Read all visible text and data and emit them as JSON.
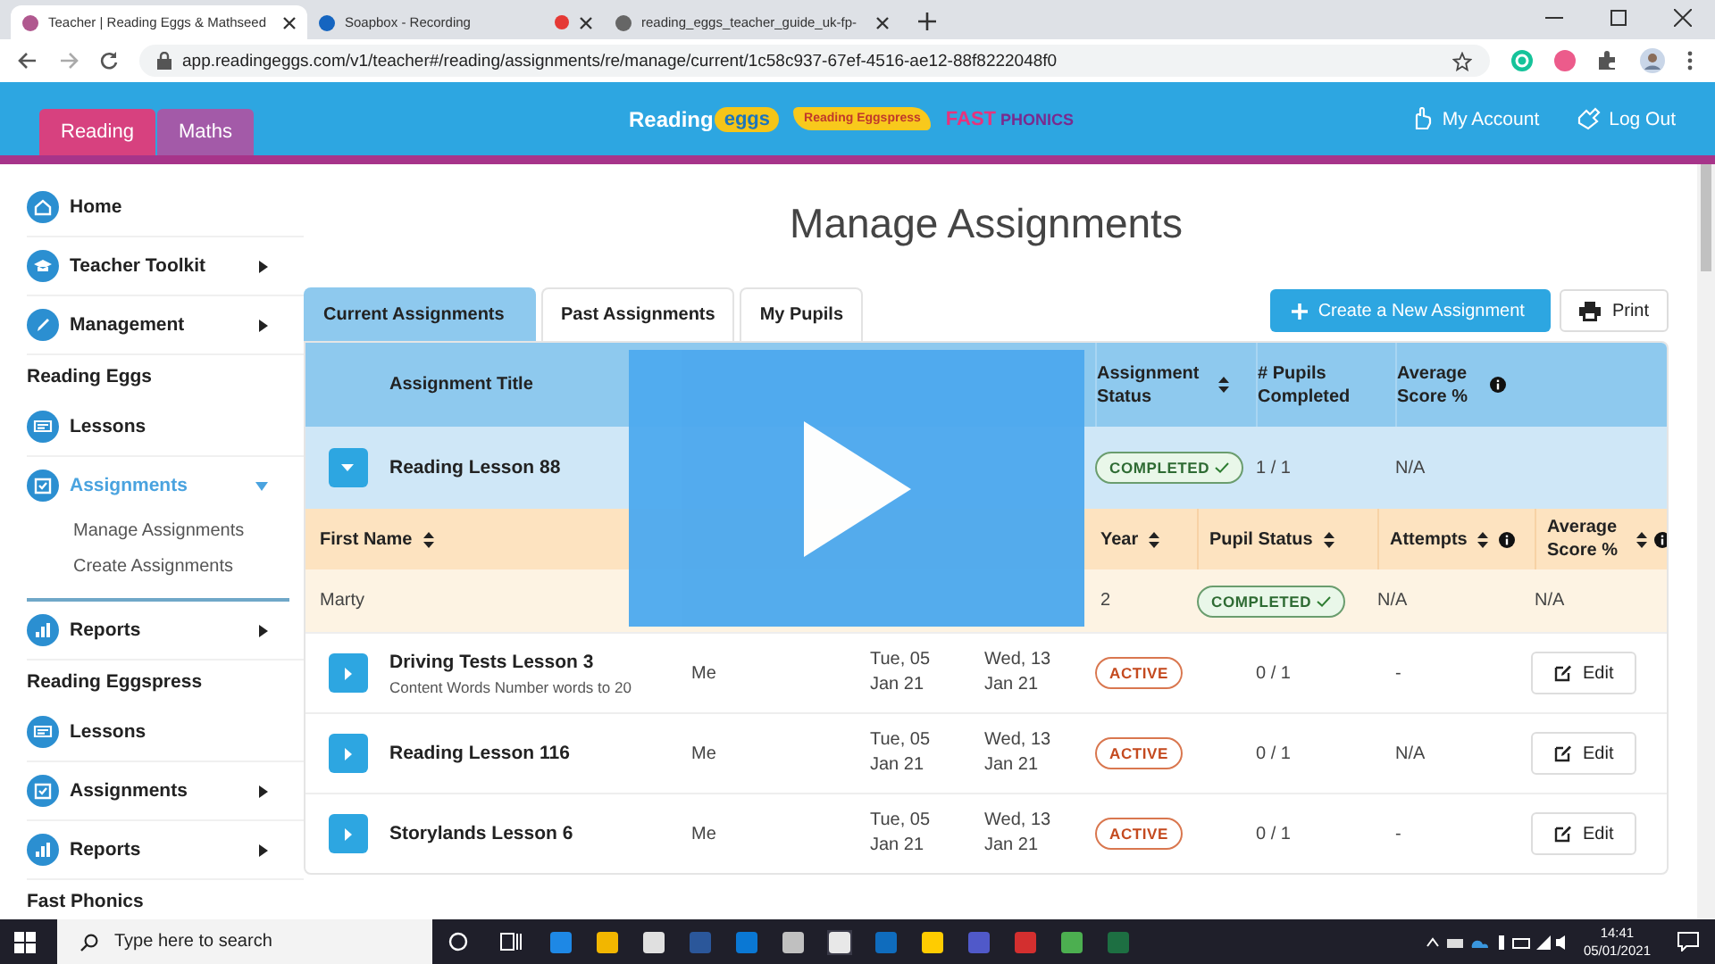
{
  "browser": {
    "tabs": [
      {
        "title": "Teacher | Reading Eggs & Mathseed",
        "selected": true,
        "recording": false
      },
      {
        "title": "Soapbox - Recording",
        "selected": false,
        "recording": true
      },
      {
        "title": "reading_eggs_teacher_guide_uk-fp-",
        "selected": false,
        "recording": false
      }
    ],
    "address": "app.readingeggs.com/v1/teacher#/reading/assignments/re/manage/current/1c58c937-67ef-4516-ae12-88f8222048f0"
  },
  "header": {
    "subject_tabs": [
      {
        "label": "Reading",
        "selected": true
      },
      {
        "label": "Maths",
        "selected": false
      }
    ],
    "logos": [
      "Reading",
      "eggs",
      "Reading Eggspress",
      "FAST",
      "PHONICS"
    ],
    "links": [
      "My Account",
      "Log Out"
    ]
  },
  "sidebar": {
    "items": [
      {
        "kind": "item",
        "label": "Home",
        "selected": false
      },
      {
        "kind": "item",
        "label": "Teacher Toolkit",
        "selected": false,
        "expanded": false
      },
      {
        "kind": "item",
        "label": "Management",
        "selected": false,
        "expanded": false
      },
      {
        "kind": "section",
        "label": "Reading Eggs"
      },
      {
        "kind": "item",
        "label": "Lessons",
        "selected": false
      },
      {
        "kind": "item",
        "label": "Assignments",
        "selected": true,
        "expanded": true,
        "children": [
          {
            "label": "Manage Assignments"
          },
          {
            "label": "Create Assignments"
          }
        ]
      },
      {
        "kind": "item",
        "label": "Reports",
        "selected": false,
        "expanded": false
      },
      {
        "kind": "section",
        "label": "Reading Eggspress"
      },
      {
        "kind": "item",
        "label": "Lessons",
        "selected": false
      },
      {
        "kind": "item",
        "label": "Assignments",
        "selected": false,
        "expanded": false
      },
      {
        "kind": "item",
        "label": "Reports",
        "selected": false,
        "expanded": false
      },
      {
        "kind": "section",
        "label": "Fast Phonics"
      }
    ]
  },
  "page_title": "Manage Assignments",
  "tabs": [
    {
      "label": "Current Assignments",
      "selected": true
    },
    {
      "label": "Past Assignments",
      "selected": false
    },
    {
      "label": "My Pupils",
      "selected": false
    }
  ],
  "buttons": {
    "create": "Create a New Assignment",
    "print": "Print"
  },
  "table": {
    "columns": [
      {
        "label": "Assignment Title",
        "sortable": false,
        "info": false
      },
      {
        "label": "Assignment Status",
        "sortable": true,
        "info": false
      },
      {
        "label": "# Pupils Completed",
        "sortable": false,
        "info": false
      },
      {
        "label": "Average Score %",
        "sortable": false,
        "info": true
      }
    ],
    "rows": [
      {
        "expanded": true,
        "title": "Reading Lesson 88",
        "status": {
          "label": "COMPLETED",
          "kind": "completed"
        },
        "pupils_completed": "1 / 1",
        "average_score": "N/A",
        "pupils": {
          "columns": [
            {
              "label": "First Name",
              "sortable": true,
              "info": false
            },
            {
              "label": "Year",
              "sortable": true,
              "info": false
            },
            {
              "label": "Pupil Status",
              "sortable": true,
              "info": false
            },
            {
              "label": "Attempts",
              "sortable": true,
              "info": true
            },
            {
              "label": "Average Score %",
              "sortable": true,
              "info": true
            }
          ],
          "rows": [
            {
              "first_name": "Marty",
              "year": "2",
              "status": {
                "label": "COMPLETED",
                "kind": "completed"
              },
              "attempts": "N/A",
              "average_score": "N/A"
            }
          ]
        }
      },
      {
        "expanded": false,
        "title": "Driving Tests Lesson 3",
        "subtitle": "Content Words Number words to 20",
        "assigned_by": "Me",
        "start_date": "Tue, 05 Jan 21",
        "due_date": "Wed, 13 Jan 21",
        "status": {
          "label": "ACTIVE",
          "kind": "active"
        },
        "pupils_completed": "0 / 1",
        "average_score": "-",
        "action": "Edit"
      },
      {
        "expanded": false,
        "title": "Reading Lesson 116",
        "assigned_by": "Me",
        "start_date": "Tue, 05 Jan 21",
        "due_date": "Wed, 13 Jan 21",
        "status": {
          "label": "ACTIVE",
          "kind": "active"
        },
        "pupils_completed": "0 / 1",
        "average_score": "N/A",
        "action": "Edit"
      },
      {
        "expanded": false,
        "title": "Storylands Lesson 6",
        "assigned_by": "Me",
        "start_date": "Tue, 05 Jan 21",
        "due_date": "Wed, 13 Jan 21",
        "status": {
          "label": "ACTIVE",
          "kind": "active"
        },
        "pupils_completed": "0 / 1",
        "average_score": "-",
        "action": "Edit"
      }
    ]
  },
  "taskbar": {
    "search_placeholder": "Type here to search",
    "time": "14:41",
    "date": "05/01/2021"
  }
}
